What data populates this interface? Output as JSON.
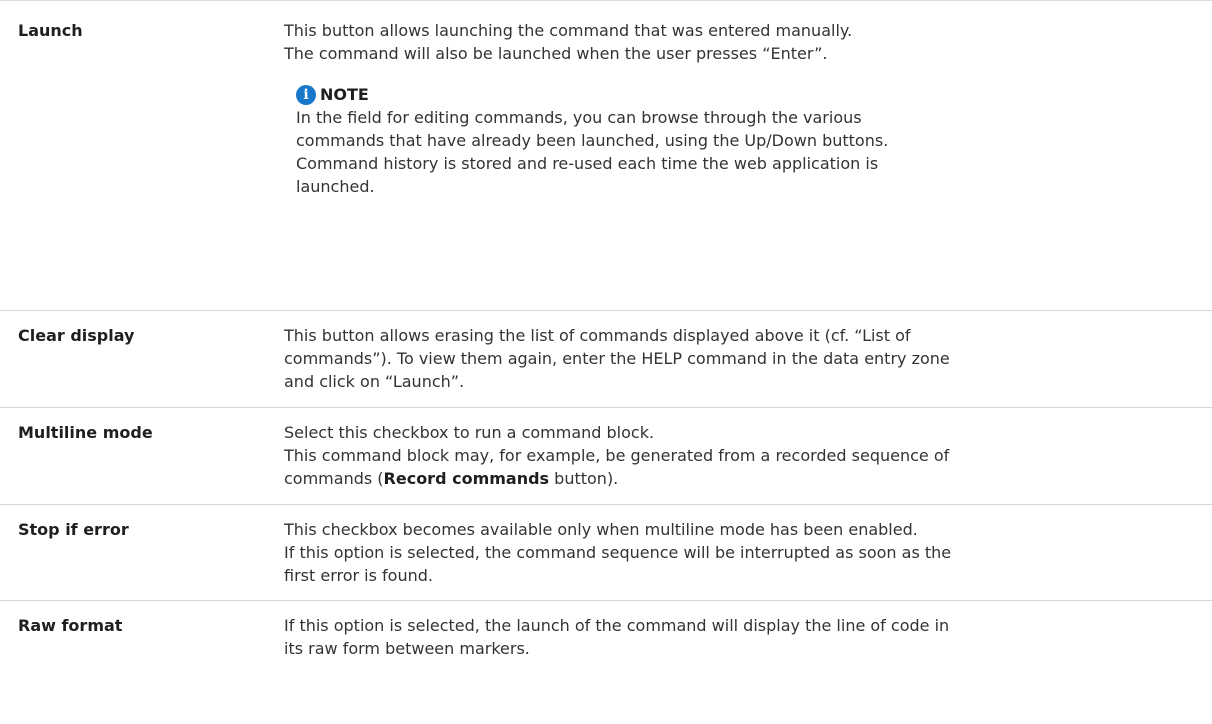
{
  "rows": [
    {
      "term": "Launch",
      "lines": [
        "This button allows launching the command that was entered manually.",
        "The command will also be launched when the user presses “Enter”."
      ],
      "note": {
        "label": "NOTE",
        "lines": [
          "In the field for editing commands, you can browse through the various",
          "commands that have already been launched, using the Up/Down buttons.",
          "Command history is stored and re-used each time the web application is",
          "launched."
        ]
      }
    },
    {
      "term": "Clear display",
      "lines": [
        "This button allows erasing the list of commands displayed above it (cf. “List of",
        "commands”). To view them again, enter the HELP command in the data entry zone",
        "and click on “Launch”."
      ]
    },
    {
      "term": "Multiline mode",
      "lines": [
        "Select this checkbox to run a command block.",
        "This command block may, for example, be generated from a recorded sequence of"
      ],
      "line3": {
        "pre": "commands (",
        "bold": "Record commands",
        "post": " button)."
      }
    },
    {
      "term": "Stop if error",
      "lines": [
        "This checkbox becomes available only when multiline mode has been enabled.",
        "If this option is selected, the command sequence will be interrupted as soon as the",
        "first error is found."
      ]
    },
    {
      "term": "Raw format",
      "lines": [
        "If this option is selected, the launch of the command will display the line of code in",
        "its raw form between markers."
      ]
    }
  ],
  "colors": {
    "info_icon": "#1877c9",
    "divider": "#d6d6d6"
  },
  "icons": {
    "note": "info-icon"
  }
}
